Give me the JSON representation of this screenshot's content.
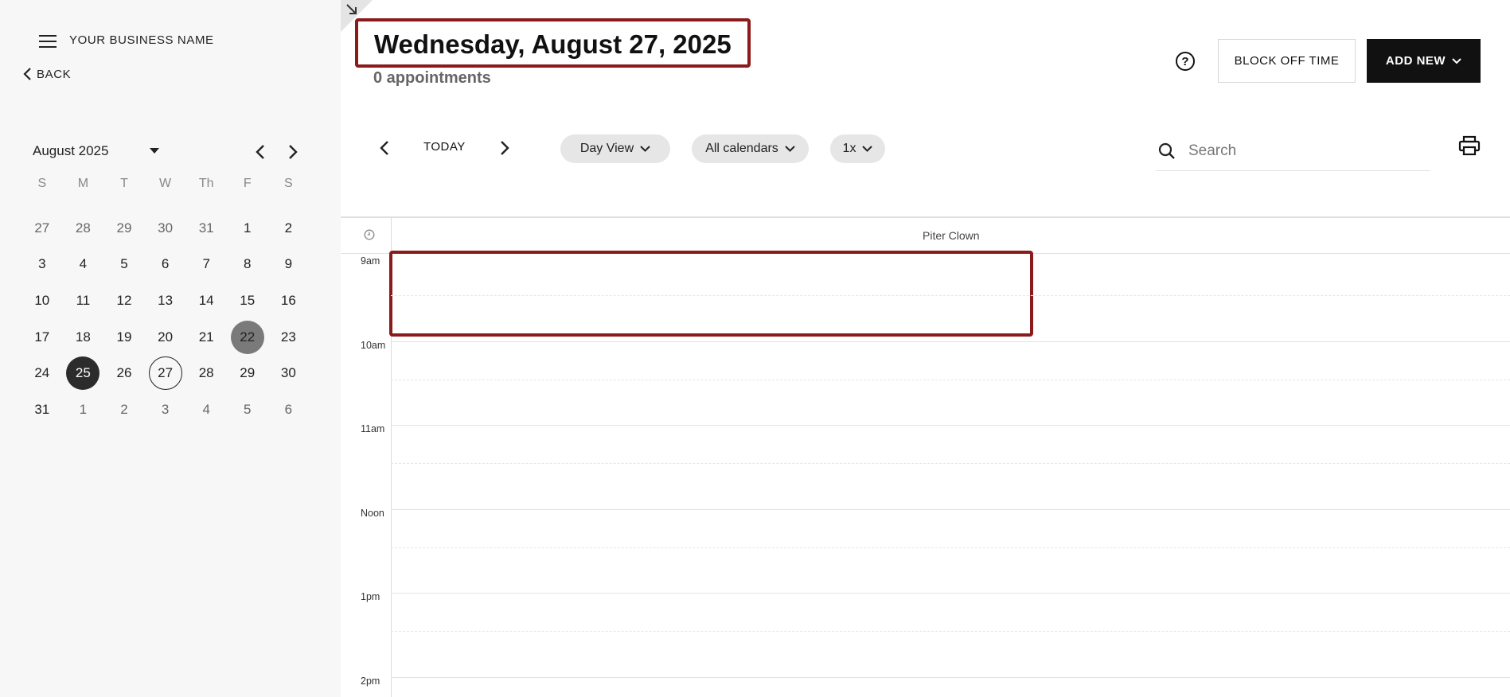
{
  "sidebar": {
    "business_name": "YOUR BUSINESS NAME",
    "back_label": "BACK",
    "mini_calendar": {
      "month_label": "August 2025",
      "weekdays": [
        "S",
        "M",
        "T",
        "W",
        "Th",
        "F",
        "S"
      ],
      "weeks": [
        [
          "27",
          "28",
          "29",
          "30",
          "31",
          "1",
          "2"
        ],
        [
          "3",
          "4",
          "5",
          "6",
          "7",
          "8",
          "9"
        ],
        [
          "10",
          "11",
          "12",
          "13",
          "14",
          "15",
          "16"
        ],
        [
          "17",
          "18",
          "19",
          "20",
          "21",
          "22",
          "23"
        ],
        [
          "24",
          "25",
          "26",
          "27",
          "28",
          "29",
          "30"
        ],
        [
          "31",
          "1",
          "2",
          "3",
          "4",
          "5",
          "6"
        ]
      ],
      "selected_day": "25",
      "today_day": "27",
      "marked_day": "22"
    }
  },
  "header": {
    "date_title": "Wednesday, August 27, 2025",
    "appointment_count": "0 appointments",
    "help_glyph": "?",
    "block_off_label": "BLOCK OFF TIME",
    "add_new_label": "ADD NEW"
  },
  "toolbar": {
    "today_label": "TODAY",
    "view_label": "Day View",
    "calendars_label": "All calendars",
    "zoom_label": "1x",
    "search_placeholder": "Search"
  },
  "grid": {
    "staff_name": "Piter Clown",
    "time_labels": [
      "9am",
      "10am",
      "11am",
      "Noon",
      "1pm",
      "2pm"
    ]
  },
  "colors": {
    "highlight_border": "#8b1a1a",
    "primary_button": "#111111",
    "selected_day": "#2c2c2c",
    "marked_day": "#7a7a7a"
  },
  "icons": {
    "menu": "hamburger-icon",
    "back": "chevron-left-icon",
    "help": "question-circle-icon",
    "search": "search-icon",
    "print": "printer-icon",
    "clock": "clock-icon"
  }
}
